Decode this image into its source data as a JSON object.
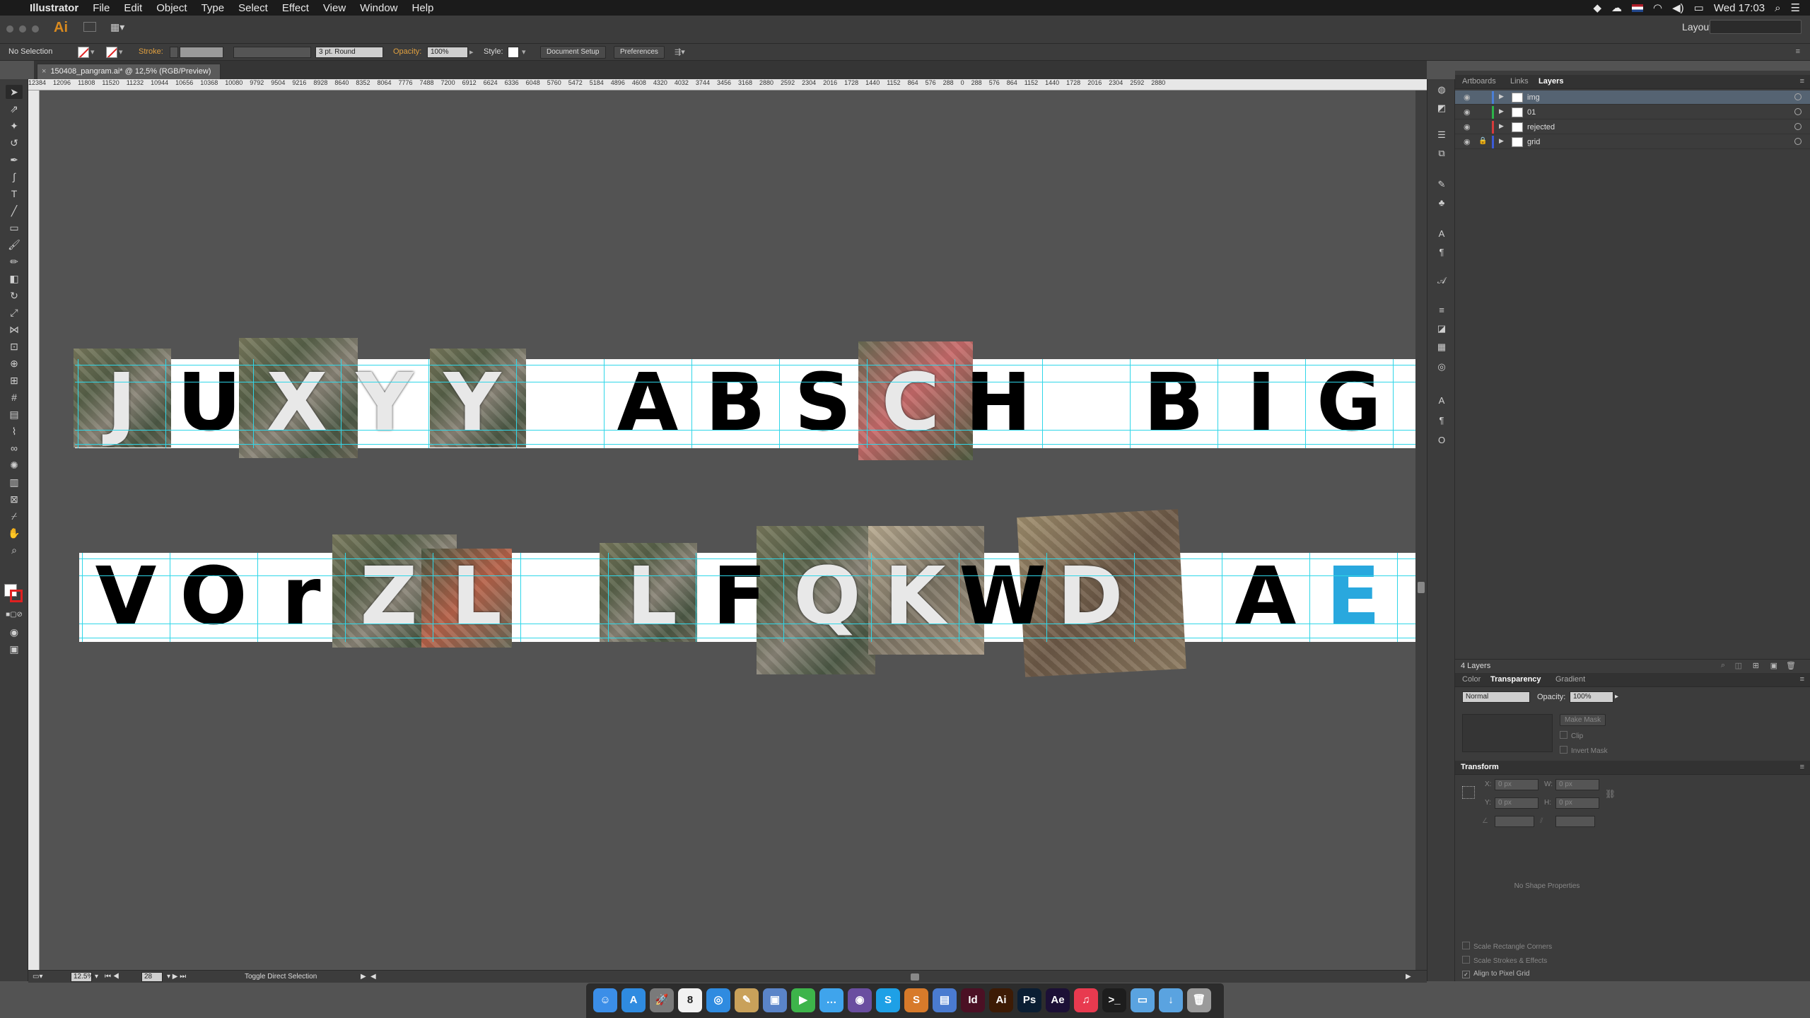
{
  "menubar": {
    "apple": "",
    "items": [
      "Illustrator",
      "File",
      "Edit",
      "Object",
      "Type",
      "Select",
      "Effect",
      "View",
      "Window",
      "Help"
    ],
    "clock": "Wed 17:03"
  },
  "appbar": {
    "logo": "Ai",
    "workspace": "Layout ▾",
    "search_placeholder": ""
  },
  "controlbar": {
    "selection": "No Selection",
    "stroke_label": "Stroke:",
    "brush": "3 pt. Round",
    "opacity_label": "Opacity:",
    "opacity_value": "100%",
    "style_label": "Style:",
    "document_setup": "Document Setup",
    "preferences": "Preferences"
  },
  "document": {
    "tab_title": "150408_pangram.ai* @ 12,5% (RGB/Preview)",
    "close": "×"
  },
  "ruler": {
    "ticks": [
      "12384",
      "12096",
      "11808",
      "11520",
      "11232",
      "10944",
      "10656",
      "10368",
      "10080",
      "9792",
      "9504",
      "9216",
      "8928",
      "8640",
      "8352",
      "8064",
      "7776",
      "7488",
      "7200",
      "6912",
      "6624",
      "6336",
      "6048",
      "5760",
      "5472",
      "5184",
      "4896",
      "4608",
      "4320",
      "4032",
      "3744",
      "3456",
      "3168",
      "2880",
      "2592",
      "2304",
      "2016",
      "1728",
      "1440",
      "1152",
      "864",
      "576",
      "288",
      "0",
      "288",
      "576",
      "864",
      "1152",
      "1440",
      "1728",
      "2016",
      "2304",
      "2592",
      "2880"
    ]
  },
  "artboard": {
    "row1": [
      "J",
      "U",
      "X",
      "Y",
      "Y",
      "",
      "A",
      "B",
      "S",
      "C",
      "H",
      "",
      "B",
      "I",
      "G"
    ],
    "row2": [
      "V",
      "O",
      "r",
      "Z",
      "L",
      "",
      "L",
      "F",
      "Q",
      "K",
      "W",
      "D",
      "",
      "A",
      "E"
    ]
  },
  "statusbar": {
    "zoom": "12.5%",
    "page": "28",
    "tool": "Toggle Direct Selection"
  },
  "layers_panel": {
    "tabs": [
      "Artboards",
      "Links",
      "Layers"
    ],
    "active_tab": "Layers",
    "layers": [
      {
        "name": "img",
        "color": "#4a7fd6",
        "selected": true,
        "locked": false
      },
      {
        "name": "01",
        "color": "#2db34a",
        "selected": false,
        "locked": false
      },
      {
        "name": "rejected",
        "color": "#d63b3b",
        "selected": false,
        "locked": false
      },
      {
        "name": "grid",
        "color": "#3c5bd6",
        "selected": false,
        "locked": true
      }
    ],
    "footer": "4 Layers"
  },
  "transparency_panel": {
    "tabs": [
      "Color",
      "Transparency",
      "Gradient"
    ],
    "active_tab": "Transparency",
    "blend_mode": "Normal",
    "opacity_label": "Opacity:",
    "opacity_value": "100%",
    "make_mask": "Make Mask",
    "clip": "Clip",
    "invert_mask": "Invert Mask"
  },
  "transform_panel": {
    "title": "Transform",
    "x_label": "X:",
    "x_value": "0 px",
    "y_label": "Y:",
    "y_value": "0 px",
    "w_label": "W:",
    "w_value": "0 px",
    "h_label": "H:",
    "h_value": "0 px",
    "no_shape": "No Shape Properties",
    "scale_corners": "Scale Rectangle Corners",
    "scale_strokes": "Scale Strokes & Effects",
    "align_pixel": "Align to Pixel Grid"
  },
  "dock": {
    "apps": [
      {
        "name": "finder",
        "label": "☺",
        "color": "#3b8ee8"
      },
      {
        "name": "app-store",
        "label": "A",
        "color": "#2f8be0"
      },
      {
        "name": "launchpad",
        "label": "🚀",
        "color": "#7a7a7a"
      },
      {
        "name": "calendar",
        "label": "8",
        "color": "#f2f2f2"
      },
      {
        "name": "safari",
        "label": "◎",
        "color": "#2f8be0"
      },
      {
        "name": "notes",
        "label": "✎",
        "color": "#c9a15a"
      },
      {
        "name": "preview",
        "label": "▣",
        "color": "#5a84c8"
      },
      {
        "name": "facetime",
        "label": "▶",
        "color": "#3db44a"
      },
      {
        "name": "messages",
        "label": "…",
        "color": "#3fa4ec"
      },
      {
        "name": "github",
        "label": "◉",
        "color": "#6a4ea0"
      },
      {
        "name": "skype",
        "label": "S",
        "color": "#1ea0e6"
      },
      {
        "name": "sublime",
        "label": "S",
        "color": "#d77a2a"
      },
      {
        "name": "keynote",
        "label": "▤",
        "color": "#4a7bd0"
      },
      {
        "name": "indesign",
        "label": "Id",
        "color": "#4b1024"
      },
      {
        "name": "illustrator",
        "label": "Ai",
        "color": "#3d1b05"
      },
      {
        "name": "photoshop",
        "label": "Ps",
        "color": "#0b1e33"
      },
      {
        "name": "after-effects",
        "label": "Ae",
        "color": "#1c1036"
      },
      {
        "name": "itunes",
        "label": "♫",
        "color": "#e83a4f"
      },
      {
        "name": "terminal",
        "label": ">_",
        "color": "#1d1d1d"
      },
      {
        "name": "folder",
        "label": "▭",
        "color": "#5aa3e0"
      },
      {
        "name": "downloads",
        "label": "↓",
        "color": "#5aa3e0"
      },
      {
        "name": "trash",
        "label": "🗑",
        "color": "#9a9a9a"
      }
    ]
  }
}
